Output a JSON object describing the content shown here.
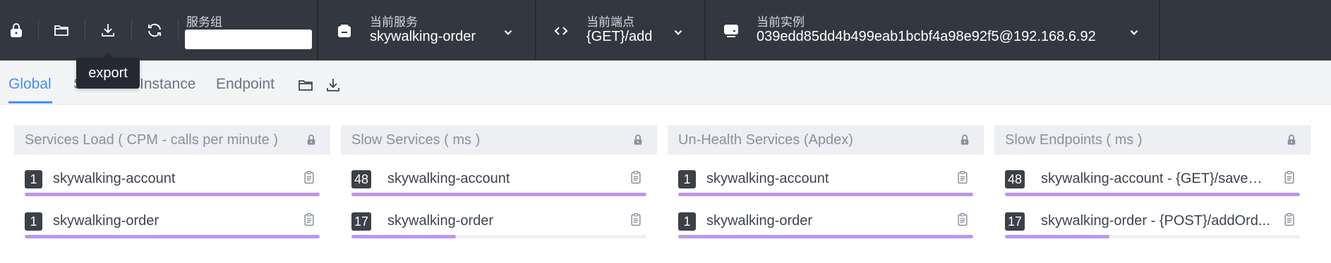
{
  "toolbar": {
    "buttons": [
      {
        "icon": "lock-icon"
      },
      {
        "icon": "folder-icon"
      },
      {
        "icon": "download-icon"
      },
      {
        "icon": "refresh-icon"
      }
    ],
    "service_group": {
      "label": "服务组",
      "value": ""
    },
    "current_service": {
      "label": "当前服务",
      "value": "skywalking-order",
      "icon": "service-icon"
    },
    "current_endpoint": {
      "label": "当前端点",
      "value": "{GET}/add",
      "icon": "code-icon"
    },
    "current_instance": {
      "label": "当前实例",
      "value": "039edd85dd4b499eab1bcbf4a98e92f5@192.168.6.92",
      "icon": "server-icon"
    }
  },
  "tooltip": {
    "text": "export"
  },
  "tabs": [
    {
      "label": "Global",
      "active": true
    },
    {
      "label": "Service",
      "active": false
    },
    {
      "label": "Instance",
      "active": false
    },
    {
      "label": "Endpoint",
      "active": false
    }
  ],
  "tab_tools": [
    {
      "icon": "folder-icon"
    },
    {
      "icon": "download-icon"
    }
  ],
  "panels": [
    {
      "title": "Services Load ( CPM - calls per minute )",
      "rows": [
        {
          "badge": "1",
          "name": "skywalking-account",
          "fill": 1.0
        },
        {
          "badge": "1",
          "name": "skywalking-order",
          "fill": 1.0
        }
      ]
    },
    {
      "title": "Slow Services ( ms )",
      "rows": [
        {
          "badge": "48",
          "name": "skywalking-account",
          "fill": 1.0
        },
        {
          "badge": "17",
          "name": "skywalking-order",
          "fill": 0.354
        }
      ]
    },
    {
      "title": "Un-Health Services (Apdex)",
      "rows": [
        {
          "badge": "1",
          "name": "skywalking-account",
          "fill": 1.0
        },
        {
          "badge": "1",
          "name": "skywalking-order",
          "fill": 1.0
        }
      ]
    },
    {
      "title": "Slow Endpoints ( ms )",
      "rows": [
        {
          "badge": "48",
          "name": "skywalking-account - {GET}/saveOr...",
          "fill": 1.0
        },
        {
          "badge": "17",
          "name": "skywalking-order - {POST}/addOrd...",
          "fill": 0.354
        }
      ]
    }
  ],
  "colors": {
    "toolbar_bg": "#333840",
    "accent": "#448dfe",
    "bar_fill": "#bd96f0",
    "badge_bg": "#3c4148"
  }
}
